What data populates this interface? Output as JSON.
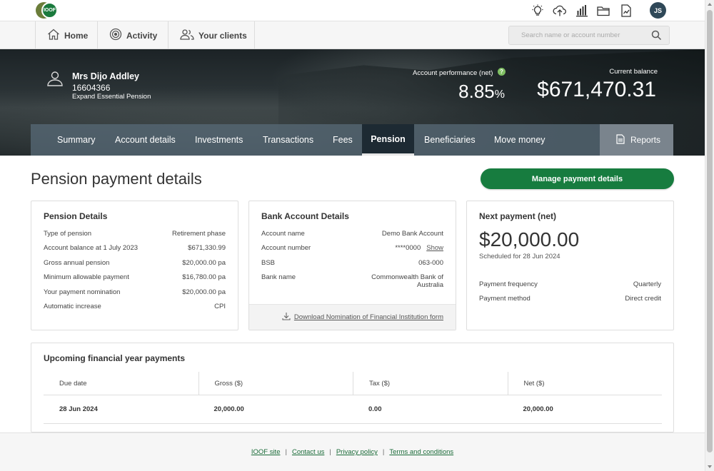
{
  "brand": {
    "logo_text": "IOOF"
  },
  "topbar": {
    "icons": [
      "lightbulb-icon",
      "upload-icon",
      "bar-chart-icon",
      "folder-icon",
      "document-chart-icon"
    ],
    "avatar_initials": "JS"
  },
  "nav": {
    "home": "Home",
    "activity": "Activity",
    "clients": "Your clients",
    "search_placeholder": "Search name or account number"
  },
  "client": {
    "name": "Mrs Dijo Addley",
    "account_number": "16604366",
    "product": "Expand Essential Pension",
    "performance_label": "Account performance (net)",
    "performance_value": "8.85",
    "performance_unit": "%",
    "balance_label": "Current balance",
    "balance_value": "$671,470.31"
  },
  "tabs": [
    "Summary",
    "Account details",
    "Investments",
    "Transactions",
    "Fees",
    "Pension",
    "Beneficiaries",
    "Move money"
  ],
  "active_tab": "Pension",
  "reports_label": "Reports",
  "page": {
    "title": "Pension payment details",
    "manage_button": "Manage payment details"
  },
  "pension_details": {
    "title": "Pension Details",
    "rows": [
      {
        "label": "Type of pension",
        "value": "Retirement phase"
      },
      {
        "label": "Account balance at 1 July 2023",
        "value": "$671,330.99"
      },
      {
        "label": "Gross annual pension",
        "value": "$20,000.00 pa"
      },
      {
        "label": "Minimum allowable payment",
        "value": "$16,780.00 pa"
      },
      {
        "label": "Your payment nomination",
        "value": "$20,000.00 pa"
      },
      {
        "label": "Automatic increase",
        "value": "CPI"
      }
    ]
  },
  "bank_details": {
    "title": "Bank Account Details",
    "account_name_label": "Account name",
    "account_name": "Demo Bank Account",
    "account_number_label": "Account number",
    "account_number": "****0000",
    "show_link": "Show",
    "bsb_label": "BSB",
    "bsb": "063-000",
    "bank_name_label": "Bank name",
    "bank_name_line1": "Commonwealth Bank of",
    "bank_name_line2": "Australia",
    "download_link": "Download Nomination of Financial Institution form"
  },
  "next_payment": {
    "title": "Next payment (net)",
    "amount": "$20,000.00",
    "scheduled": "Scheduled for 28 Jun 2024",
    "frequency_label": "Payment frequency",
    "frequency": "Quarterly",
    "method_label": "Payment method",
    "method": "Direct credit"
  },
  "upcoming": {
    "title": "Upcoming financial year payments",
    "headers": [
      "Due date",
      "Gross ($)",
      "Tax ($)",
      "Net ($)"
    ],
    "rows": [
      [
        "28 Jun 2024",
        "20,000.00",
        "0.00",
        "20,000.00"
      ]
    ]
  },
  "footer": {
    "links": [
      "IOOF site",
      "Contact us",
      "Privacy policy",
      "Terms and conditions"
    ]
  },
  "colors": {
    "brand_green": "#177c3f",
    "tab_bar": "#566874",
    "active_tab": "#1d2a33",
    "help_icon": "#7fbf63"
  }
}
